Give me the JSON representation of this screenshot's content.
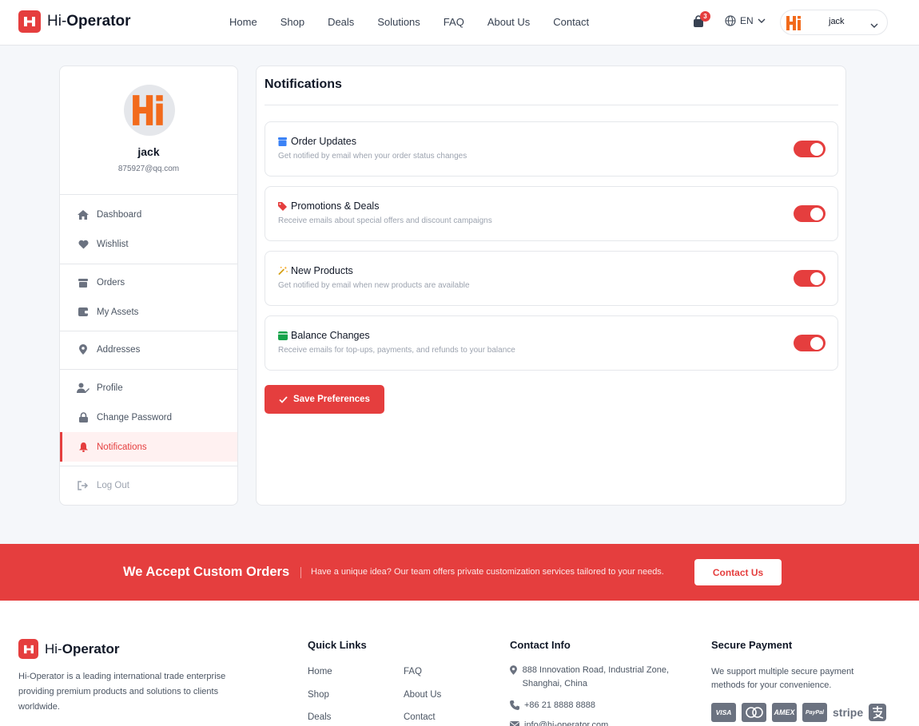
{
  "header": {
    "logo_prefix": "Hi-",
    "logo_bold": "Operator",
    "nav": [
      "Home",
      "Shop",
      "Deals",
      "Solutions",
      "FAQ",
      "About Us",
      "Contact"
    ],
    "cart_count": "3",
    "language": "EN",
    "user_name": "jack"
  },
  "sidebar": {
    "name": "jack",
    "email": "875927@qq.com",
    "items": {
      "dashboard": "Dashboard",
      "wishlist": "Wishlist",
      "orders": "Orders",
      "assets": "My Assets",
      "addresses": "Addresses",
      "profile": "Profile",
      "password": "Change Password",
      "notifications": "Notifications",
      "logout": "Log Out"
    }
  },
  "main": {
    "title": "Notifications",
    "prefs": [
      {
        "title": "Order Updates",
        "desc": "Get notified by email when your order status changes",
        "enabled": true
      },
      {
        "title": "Promotions & Deals",
        "desc": "Receive emails about special offers and discount campaigns",
        "enabled": true
      },
      {
        "title": "New Products",
        "desc": "Get notified by email when new products are available",
        "enabled": true
      },
      {
        "title": "Balance Changes",
        "desc": "Receive emails for top-ups, payments, and refunds to your balance",
        "enabled": true
      }
    ],
    "save_label": "Save Preferences"
  },
  "banner": {
    "title": "We Accept Custom Orders",
    "text": "Have a unique idea? Our team offers private customization services tailored to your needs.",
    "button": "Contact Us"
  },
  "footer": {
    "about": "Hi-Operator is a leading international trade enterprise providing premium products and solutions to clients worldwide.",
    "quick_links_title": "Quick Links",
    "quick_links": [
      "Home",
      "FAQ",
      "Shop",
      "About Us",
      "Deals",
      "Contact"
    ],
    "contact_title": "Contact Info",
    "address": "888 Innovation Road, Industrial Zone, Shanghai, China",
    "phone": "+86 21 8888 8888",
    "email": "info@hi-operator.com",
    "payment_title": "Secure Payment",
    "payment_text": "We support multiple secure payment methods for your convenience.",
    "payment_methods": [
      "VISA",
      "MasterCard",
      "AMEX",
      "PayPal",
      "stripe",
      "Alipay"
    ]
  },
  "colors": {
    "accent": "#e53e3e",
    "logo_orange": "#f26a1b"
  }
}
